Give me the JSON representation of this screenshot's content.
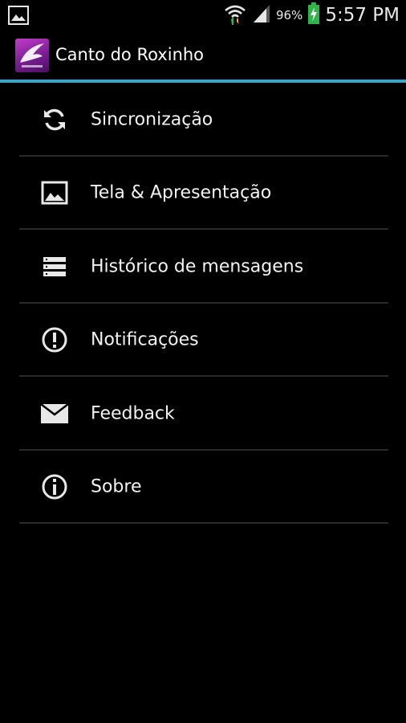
{
  "status_bar": {
    "battery_percent": "96%",
    "time": "5:57 PM",
    "icons": [
      "gallery-notification-icon",
      "wifi-icon",
      "signal-icon",
      "battery-charging-icon"
    ]
  },
  "action_bar": {
    "title": "Canto do Roxinho",
    "accent_color": "#33a6d4"
  },
  "menu": {
    "items": [
      {
        "label": "Sincronização",
        "icon": "sync-icon"
      },
      {
        "label": "Tela & Apresentação",
        "icon": "image-icon"
      },
      {
        "label": "Histórico de mensagens",
        "icon": "list-icon"
      },
      {
        "label": "Notificações",
        "icon": "alert-icon"
      },
      {
        "label": "Feedback",
        "icon": "mail-icon"
      },
      {
        "label": "Sobre",
        "icon": "info-icon"
      }
    ]
  }
}
